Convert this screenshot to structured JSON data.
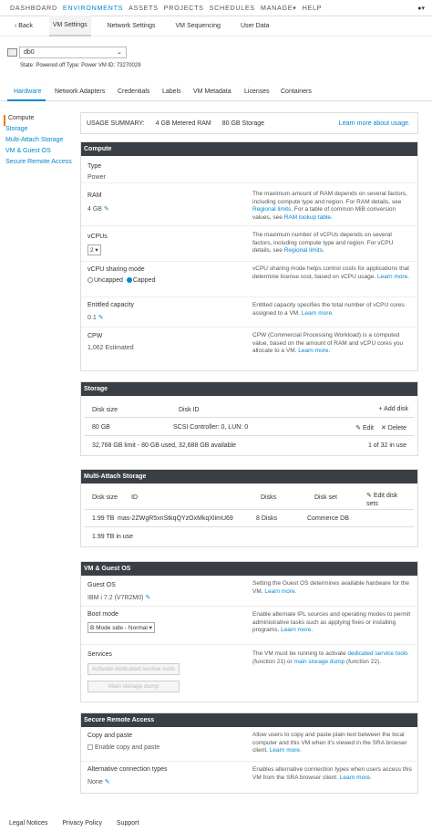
{
  "topnav": {
    "items": [
      "DASHBOARD",
      "ENVIRONMENTS",
      "ASSETS",
      "PROJECTS",
      "SCHEDULES",
      "MANAGE▾",
      "HELP"
    ],
    "user_icon": "user-icon"
  },
  "subnav": {
    "back": "Back",
    "items": [
      "VM Settings",
      "Network Settings",
      "VM Sequencing",
      "User Data"
    ]
  },
  "vm": {
    "name": "db0",
    "state_line": "State: Powered off  Type: Power  VM ID: 73270029"
  },
  "tabs": [
    "Hardware",
    "Network Adapters",
    "Credentials",
    "Labels",
    "VM Metadata",
    "Licenses",
    "Containers"
  ],
  "sidebar": [
    "Compute",
    "Storage",
    "Multi-Attach Storage",
    "VM & Guest OS",
    "Secure Remote Access"
  ],
  "usage": {
    "label": "USAGE SUMMARY:",
    "ram": "4 GB Metered RAM",
    "storage": "80 GB Storage",
    "link": "Learn more about usage."
  },
  "compute": {
    "title": "Compute",
    "type_label": "Type",
    "type_value": "Power",
    "ram_label": "RAM",
    "ram_value": "4 GB",
    "ram_desc_1": "The maximum amount of RAM depends on several factors, including compute type and region. For RAM details, see",
    "ram_desc_link1": "Regional limits",
    "ram_desc_2": ". For a table of common MiB conversion values, see",
    "ram_desc_link2": "RAM lookup table",
    "vcpu_label": "vCPUs",
    "vcpu_value": "2",
    "vcpu_desc_1": "The maximum number of vCPUs depends on several factors, including compute type and region. For vCPU details, see",
    "vcpu_desc_link": "Regional limits",
    "sharing_label": "vCPU sharing mode",
    "uncapped": "Uncapped",
    "capped": "Capped",
    "sharing_desc": "vCPU sharing mode helps control costs for applications that determine license cost, based on vCPU usage.",
    "sharing_link": "Learn more.",
    "entitled_label": "Entitled capacity",
    "entitled_value": "0.1",
    "entitled_desc": "Entitled capacity specifies the total number of vCPU cores assigned to a VM.",
    "entitled_link": "Learn more.",
    "cpw_label": "CPW",
    "cpw_value": "1,062 Estimated",
    "cpw_desc": "CPW (Commercial Processing Workload) is a computed value, based on the amount of RAM and vCPU cores you allocate to a VM.",
    "cpw_link": "Learn more."
  },
  "storage": {
    "title": "Storage",
    "col_size": "Disk size",
    "col_id": "Disk ID",
    "add_disk": "+ Add disk",
    "row_size": "80 GB",
    "row_id": "SCSI Controller: 0, LUN: 0",
    "edit": "Edit",
    "delete": "Delete",
    "limit": "32,768 GB limit - 80 GB used, 32,688 GB available",
    "count": "1 of 32 in use"
  },
  "multi": {
    "title": "Multi-Attach Storage",
    "col_size": "Disk size",
    "col_id": "ID",
    "col_disks": "Disks",
    "col_set": "Disk set",
    "edit_sets": "Edit disk sets",
    "row_size": "1.99 TB",
    "row_id": "mas-2ZWgR5xnStkqQYzOxMkqXlimU69",
    "row_disks": "8 Disks",
    "row_set": "Commerce DB",
    "in_use": "1.99 TB in use"
  },
  "guest": {
    "title": "VM & Guest OS",
    "os_label": "Guest OS",
    "os_value": "IBM i 7.2 (V7R2M0)",
    "os_desc": "Setting the Guest OS determines available hardware for the VM.",
    "os_link": "Learn more.",
    "boot_label": "Boot mode",
    "boot_value": "B Mode side - Normal",
    "boot_desc": "Enable alternate IPL sources and operating modes to permit administrative tasks such as applying fixes or installing programs.",
    "boot_link": "Learn more.",
    "services_label": "Services",
    "btn_tools": "Activate dedicated service tools",
    "btn_dump": "Main storage dump",
    "services_desc_1": "The VM must be running to activate",
    "services_link1": "dedicated service tools",
    "services_desc_2": "(function 21) or",
    "services_link2": "main storage dump",
    "services_desc_3": "(function 22)."
  },
  "sra": {
    "title": "Secure Remote Access",
    "copy_label": "Copy and paste",
    "copy_check": "Enable copy and paste",
    "copy_desc": "Allow users to copy and paste plain text between the local computer and this VM when it's viewed in the SRA browser client.",
    "copy_link": "Learn more.",
    "alt_label": "Alternative connection types",
    "alt_value": "None",
    "alt_desc": "Enables alternative connection types when users access this VM from the SRA browser client.",
    "alt_link": "Learn more."
  },
  "footer": [
    "Legal Notices",
    "Privacy Policy",
    "Support"
  ]
}
